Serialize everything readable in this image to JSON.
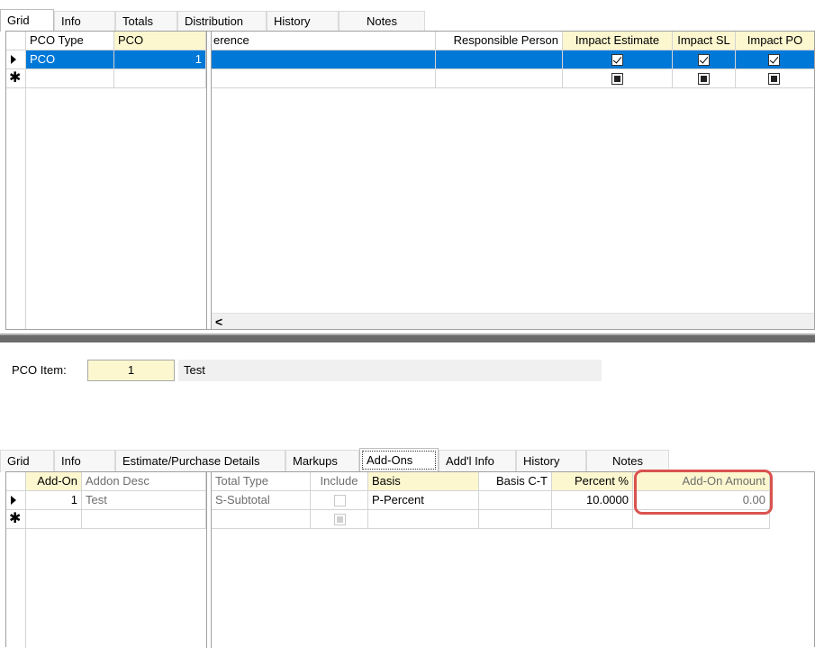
{
  "top_tabs": [
    "Grid",
    "Info",
    "Totals",
    "Distribution",
    "History",
    "Notes"
  ],
  "top_grid": {
    "left_headers": [
      "PCO Type",
      "PCO"
    ],
    "right_headers": [
      "erence",
      "Responsible Person",
      "Impact Estimate",
      "Impact SL",
      "Impact PO"
    ],
    "row1": {
      "pco_type": "PCO",
      "pco": "1"
    },
    "scroll_left_glyph": "<"
  },
  "pco_item": {
    "label": "PCO Item:",
    "number": "1",
    "description": "Test"
  },
  "bottom_tabs": [
    "Grid",
    "Info",
    "Estimate/Purchase Details",
    "Markups",
    "Add-Ons",
    "Add'l Info",
    "History",
    "Notes"
  ],
  "bottom_grid": {
    "left_headers": [
      "Add-On",
      "Addon Desc"
    ],
    "right_headers": [
      "Total Type",
      "Include",
      "Basis",
      "Basis C-T",
      "Percent %",
      "Add-On Amount"
    ],
    "row1": {
      "add_on": "1",
      "desc": "Test",
      "total_type": "S-Subtotal",
      "basis": "P-Percent",
      "percent": "10.0000",
      "amount": "0.00"
    }
  },
  "highlight_color": "#d9534f"
}
